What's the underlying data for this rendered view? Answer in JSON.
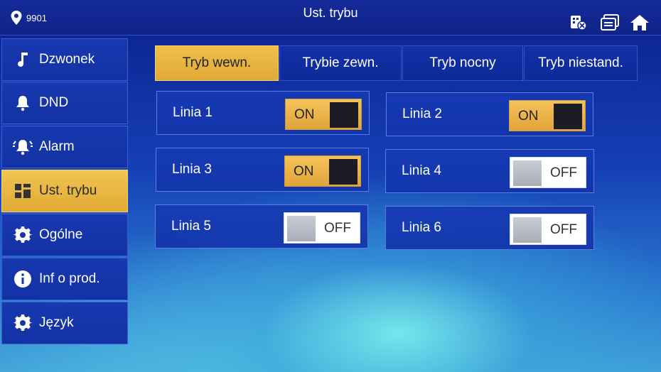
{
  "header": {
    "room_number": "9901",
    "title": "Ust. trybu"
  },
  "sidebar": {
    "items": [
      {
        "label": "Dzwonek",
        "icon": "music-note-icon"
      },
      {
        "label": "DND",
        "icon": "bell-icon"
      },
      {
        "label": "Alarm",
        "icon": "alarm-bell-icon"
      },
      {
        "label": "Ust. trybu",
        "icon": "mode-grid-icon",
        "active": true
      },
      {
        "label": "Ogólne",
        "icon": "gear-icon"
      },
      {
        "label": "Inf o prod.",
        "icon": "info-icon"
      },
      {
        "label": "Język",
        "icon": "gear-icon"
      }
    ]
  },
  "tabs": [
    {
      "label": "Tryb wewn.",
      "active": true
    },
    {
      "label": "Trybie zewn."
    },
    {
      "label": "Tryb nocny"
    },
    {
      "label": "Tryb niestand."
    }
  ],
  "lines": [
    {
      "label": "Linia 1",
      "state": "ON"
    },
    {
      "label": "Linia 2",
      "state": "ON"
    },
    {
      "label": "Linia 3",
      "state": "ON"
    },
    {
      "label": "Linia 4",
      "state": "OFF"
    },
    {
      "label": "Linia 5",
      "state": "OFF"
    },
    {
      "label": "Linia 6",
      "state": "OFF"
    }
  ],
  "colors": {
    "accent": "#e8b440",
    "background": "#1540b5"
  }
}
